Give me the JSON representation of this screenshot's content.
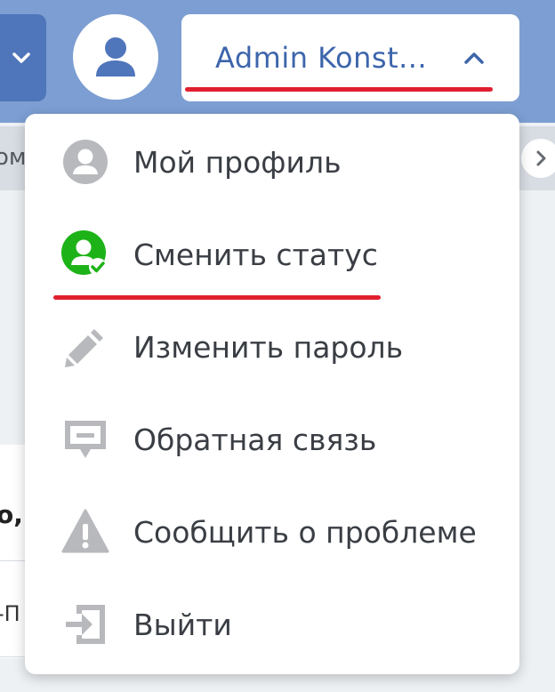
{
  "header": {
    "user_name": "Admin Konst...",
    "accent_color": "#3d65ab",
    "bar_color": "#7c9ed2"
  },
  "background": {
    "subbar_text": "ом",
    "card_text_1": "о,",
    "card_text_2": "-П"
  },
  "menu": {
    "items": [
      {
        "label": "Мой профиль",
        "icon": "user-circle-icon"
      },
      {
        "label": "Сменить статус",
        "icon": "user-status-online-icon"
      },
      {
        "label": "Изменить пароль",
        "icon": "pencil-icon"
      },
      {
        "label": "Обратная связь",
        "icon": "feedback-icon"
      },
      {
        "label": "Сообщить о проблеме",
        "icon": "warning-icon"
      },
      {
        "label": "Выйти",
        "icon": "logout-icon"
      }
    ]
  },
  "colors": {
    "status_green": "#1db318",
    "icon_gray": "#b7b9bc",
    "highlight_red": "#e0202e"
  }
}
